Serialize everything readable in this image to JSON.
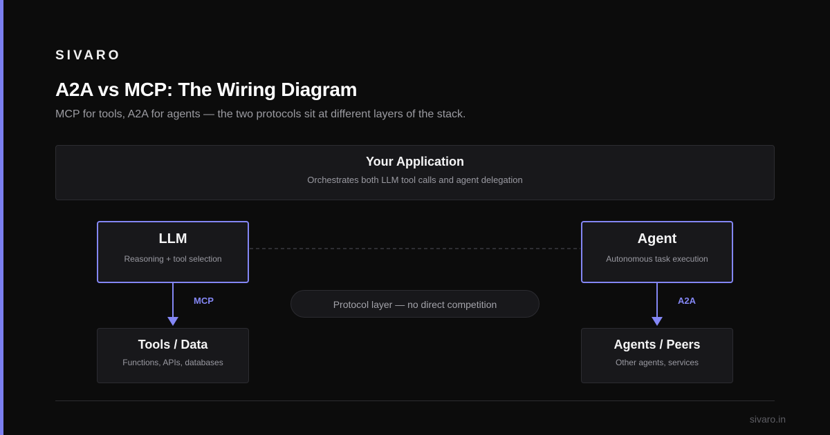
{
  "brand": "SIVARO",
  "title": "A2A vs MCP: The Wiring Diagram",
  "subtitle": "MCP for tools, A2A for agents — the two protocols sit at different layers of the stack.",
  "colors": {
    "background": "#0c0c0c",
    "accent": "#7b7ff0",
    "box_fill": "#18181b",
    "box_border": "#2c2c31"
  },
  "nodes": {
    "application": {
      "title": "Your Application",
      "desc": "Orchestrates both LLM tool calls and agent delegation"
    },
    "llm": {
      "title": "LLM",
      "desc": "Reasoning + tool selection"
    },
    "agent": {
      "title": "Agent",
      "desc": "Autonomous task execution"
    },
    "tools": {
      "title": "Tools / Data",
      "desc": "Functions, APIs, databases"
    },
    "peers": {
      "title": "Agents / Peers",
      "desc": "Other agents, services"
    }
  },
  "edges": {
    "mcp_label": "MCP",
    "a2a_label": "A2A"
  },
  "protocol_note": "Protocol layer — no direct competition",
  "footer": {
    "url": "sivaro.in"
  }
}
